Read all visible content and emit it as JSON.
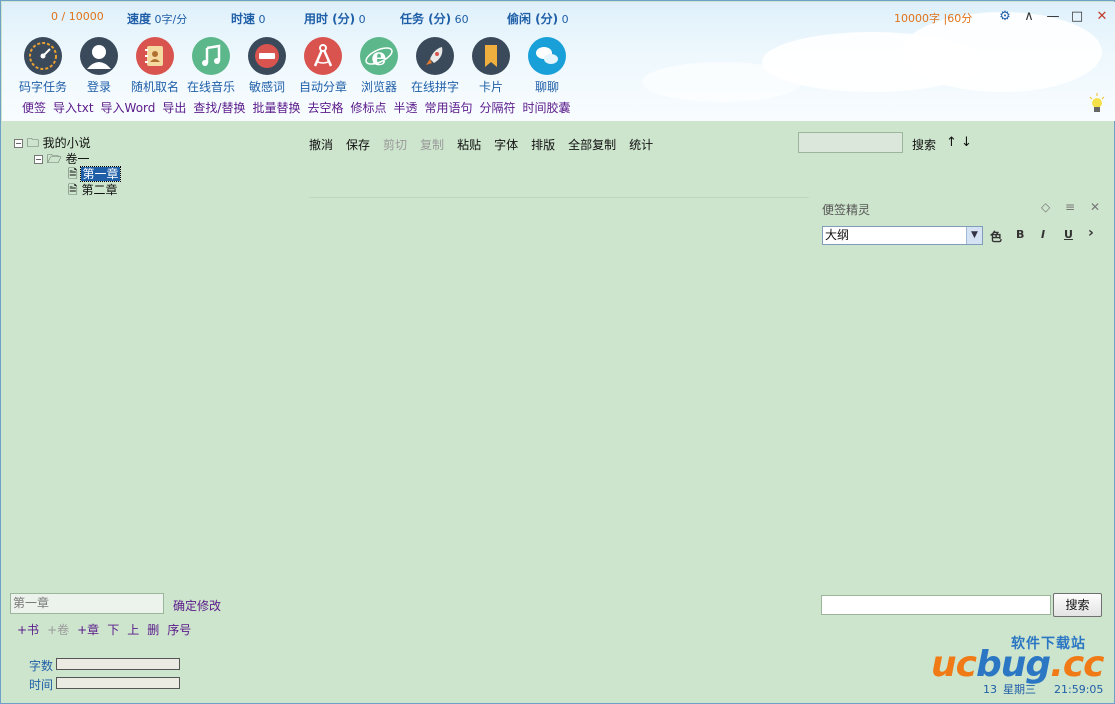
{
  "header": {
    "count": "0 / 10000",
    "stats": [
      {
        "key": "速度",
        "val": "0字/分"
      },
      {
        "key": "时速",
        "val": "0"
      },
      {
        "key": "用时 (分)",
        "val": "0"
      },
      {
        "key": "任务 (分)",
        "val": "60"
      },
      {
        "key": "偷闲 (分)",
        "val": "0"
      }
    ],
    "goal": "10000字 |60分",
    "window_controls": {
      "settings": "⚙",
      "collapse": "∧",
      "minimize": "—",
      "maximize": "□",
      "close": "✕"
    }
  },
  "tools": [
    {
      "label": "码字任务",
      "icon": "speedometer-icon",
      "color": "#4a5a6a"
    },
    {
      "label": "登录",
      "icon": "user-icon",
      "color": "#4a5a6a"
    },
    {
      "label": "随机取名",
      "icon": "address-book-icon",
      "color": "#d9534f"
    },
    {
      "label": "在线音乐",
      "icon": "music-icon",
      "color": "#5cb85c"
    },
    {
      "label": "敏感词",
      "icon": "no-entry-icon",
      "color": "#d9534f"
    },
    {
      "label": "自动分章",
      "icon": "compass-icon",
      "color": "#d9534f"
    },
    {
      "label": "浏览器",
      "icon": "browser-icon",
      "color": "#5cb85c"
    },
    {
      "label": "在线拼字",
      "icon": "rocket-icon",
      "color": "#4a5a6a"
    },
    {
      "label": "卡片",
      "icon": "bookmark-icon",
      "color": "#4a5a6a"
    },
    {
      "label": "聊聊",
      "icon": "chat-icon",
      "color": "#1aa0d8"
    }
  ],
  "links": [
    "便签",
    "导入txt",
    "导入Word",
    "导出",
    "查找/替换",
    "批量替换",
    "去空格",
    "修标点",
    "半透",
    "常用语句",
    "分隔符",
    "时间胶囊"
  ],
  "tree": {
    "root": "我的小说",
    "volume": "卷一",
    "chapters": [
      "第一章",
      "第二章"
    ]
  },
  "editor_toolbar": {
    "undo": "撤消",
    "save": "保存",
    "cut": "剪切",
    "copy": "复制",
    "paste": "粘贴",
    "font": "字体",
    "layout": "排版",
    "copy_all": "全部复制",
    "stats": "统计"
  },
  "search": {
    "label": "搜索",
    "up": "↑",
    "down": "↓"
  },
  "note": {
    "title": "便签精灵",
    "selected": "大纲",
    "format": {
      "color": "色",
      "bold": "B",
      "italic": "I",
      "underline": "U",
      "more": "›"
    }
  },
  "chapter_edit": {
    "value": "第一章",
    "confirm": "确定修改"
  },
  "ops": [
    "+书",
    "+卷",
    "+章",
    "下",
    "上",
    "删",
    "序号"
  ],
  "meters": {
    "words": "字数",
    "time": "时间"
  },
  "bottom_search": {
    "button": "搜索"
  },
  "watermark": {
    "top": "软件下载站",
    "brand_a": "uc",
    "brand_b": "bug",
    "brand_c": ".cc"
  },
  "status": {
    "day": "13",
    "weekday": "星期三",
    "time": "21:59:05"
  }
}
